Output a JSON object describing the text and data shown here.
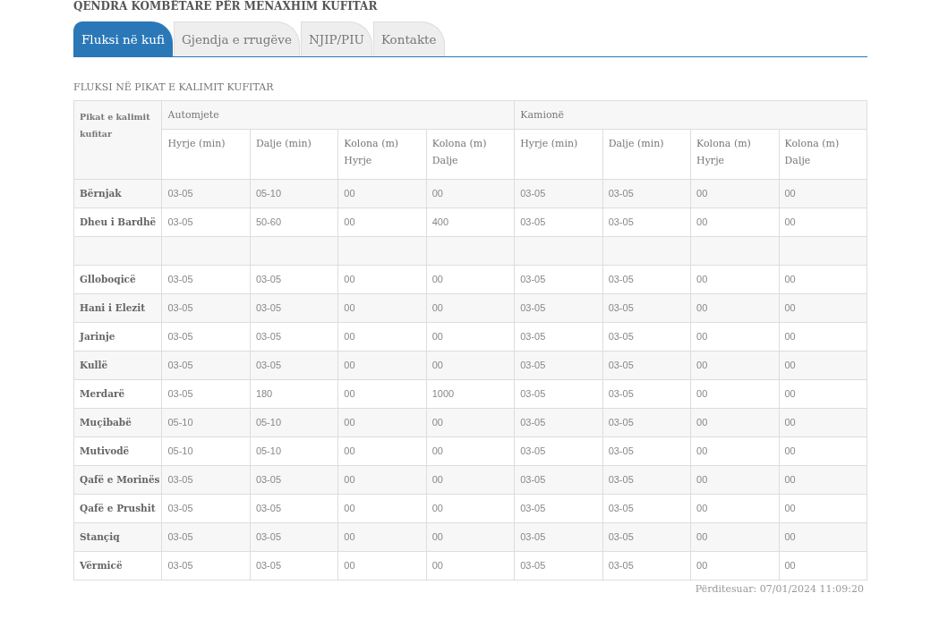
{
  "heading": "QENDRA KOMBËTARE PËR MENAXHIM KUFITAR",
  "tabs": [
    {
      "label": "Fluksi në kufi",
      "selected": true
    },
    {
      "label": "Gjendja e rrugëve",
      "selected": false
    },
    {
      "label": "NJIP/PIU",
      "selected": false
    },
    {
      "label": "Kontakte",
      "selected": false
    }
  ],
  "section_title": "FLUKSI NË PIKAT E KALIMIT KUFITAR",
  "table": {
    "corner": "Pikat e kalimit kufitar",
    "groups": [
      "Automjete",
      "Kamionë"
    ],
    "columns": [
      [
        "Hyrje (min)",
        "Dalje (min)",
        "Kolona (m) Hyrje",
        "Kolona (m) Dalje"
      ],
      [
        "Hyrje (min)",
        "Dalje (min)",
        "Kolona (m) Hyrje",
        "Kolona (m) Dalje"
      ]
    ],
    "rows": [
      {
        "kind": "data",
        "name": "Bërnjak",
        "cells": [
          "03-05",
          "05-10",
          "00",
          "00",
          "03-05",
          "03-05",
          "00",
          "00"
        ]
      },
      {
        "kind": "data",
        "name": "Dheu i Bardhë",
        "cells": [
          "03-05",
          "50-60",
          "00",
          "400",
          "03-05",
          "03-05",
          "00",
          "00"
        ]
      },
      {
        "kind": "blank"
      },
      {
        "kind": "data",
        "name": "Glloboqicë",
        "cells": [
          "03-05",
          "03-05",
          "00",
          "00",
          "03-05",
          "03-05",
          "00",
          "00"
        ]
      },
      {
        "kind": "data",
        "name": "Hani i Elezit",
        "cells": [
          "03-05",
          "03-05",
          "00",
          "00",
          "03-05",
          "03-05",
          "00",
          "00"
        ]
      },
      {
        "kind": "data",
        "name": "Jarinje",
        "cells": [
          "03-05",
          "03-05",
          "00",
          "00",
          "03-05",
          "03-05",
          "00",
          "00"
        ]
      },
      {
        "kind": "data",
        "name": "Kullë",
        "cells": [
          "03-05",
          "03-05",
          "00",
          "00",
          "03-05",
          "03-05",
          "00",
          "00"
        ]
      },
      {
        "kind": "data",
        "name": "Merdarë",
        "cells": [
          "03-05",
          "180",
          "00",
          "1000",
          "03-05",
          "03-05",
          "00",
          "00"
        ]
      },
      {
        "kind": "data",
        "name": "Muçibabë",
        "cells": [
          "05-10",
          "05-10",
          "00",
          "00",
          "03-05",
          "03-05",
          "00",
          "00"
        ]
      },
      {
        "kind": "data",
        "name": "Mutivodë",
        "cells": [
          "05-10",
          "05-10",
          "00",
          "00",
          "03-05",
          "03-05",
          "00",
          "00"
        ]
      },
      {
        "kind": "data",
        "name": "Qafë e Morinës",
        "cells": [
          "03-05",
          "03-05",
          "00",
          "00",
          "03-05",
          "03-05",
          "00",
          "00"
        ]
      },
      {
        "kind": "data",
        "name": "Qafë e Prushit",
        "cells": [
          "03-05",
          "03-05",
          "00",
          "00",
          "03-05",
          "03-05",
          "00",
          "00"
        ]
      },
      {
        "kind": "data",
        "name": "Stançiq",
        "cells": [
          "03-05",
          "03-05",
          "00",
          "00",
          "03-05",
          "03-05",
          "00",
          "00"
        ]
      },
      {
        "kind": "data",
        "name": "Vërmicë",
        "cells": [
          "03-05",
          "03-05",
          "00",
          "00",
          "03-05",
          "03-05",
          "00",
          "00"
        ]
      }
    ]
  },
  "updated": "Përditesuar: 07/01/2024 11:09:20"
}
